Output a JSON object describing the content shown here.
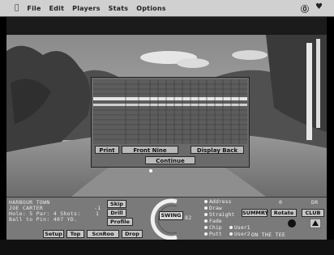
{
  "menu": {
    "items": [
      "File",
      "Edit",
      "Players",
      "Stats",
      "Options"
    ]
  },
  "scorecard": {
    "buttons": {
      "print": "Print",
      "front_nine": "Front Nine",
      "display_back": "Display Back",
      "continue": "Continue"
    }
  },
  "panel": {
    "course": "HARBOUR TOWN",
    "player": "JOE CARTER",
    "hole_line": "Hole: 5 Par: 4 Shots:",
    "distance_line": "Ball to Pin: 407 YD.",
    "player_score": "-1",
    "shots": "1",
    "club_buttons": [
      "Skip",
      "Drill",
      "Profile"
    ],
    "bottom_buttons": [
      "Setup",
      "Top",
      "ScnRoo",
      "Drop"
    ],
    "swing_label": "SWING",
    "swing_value": "82",
    "shot_options": [
      "Address",
      "Draw",
      "Straight",
      "Fade",
      "Chip",
      "Putt"
    ],
    "user_options": [
      "User1",
      "User2"
    ],
    "summary_label": "SUMMRY",
    "rotate_label": "Rotate",
    "club_label": "CLUB",
    "lie_text": "ON THE TEE",
    "club_value": "DR",
    "wind_value": "0"
  }
}
